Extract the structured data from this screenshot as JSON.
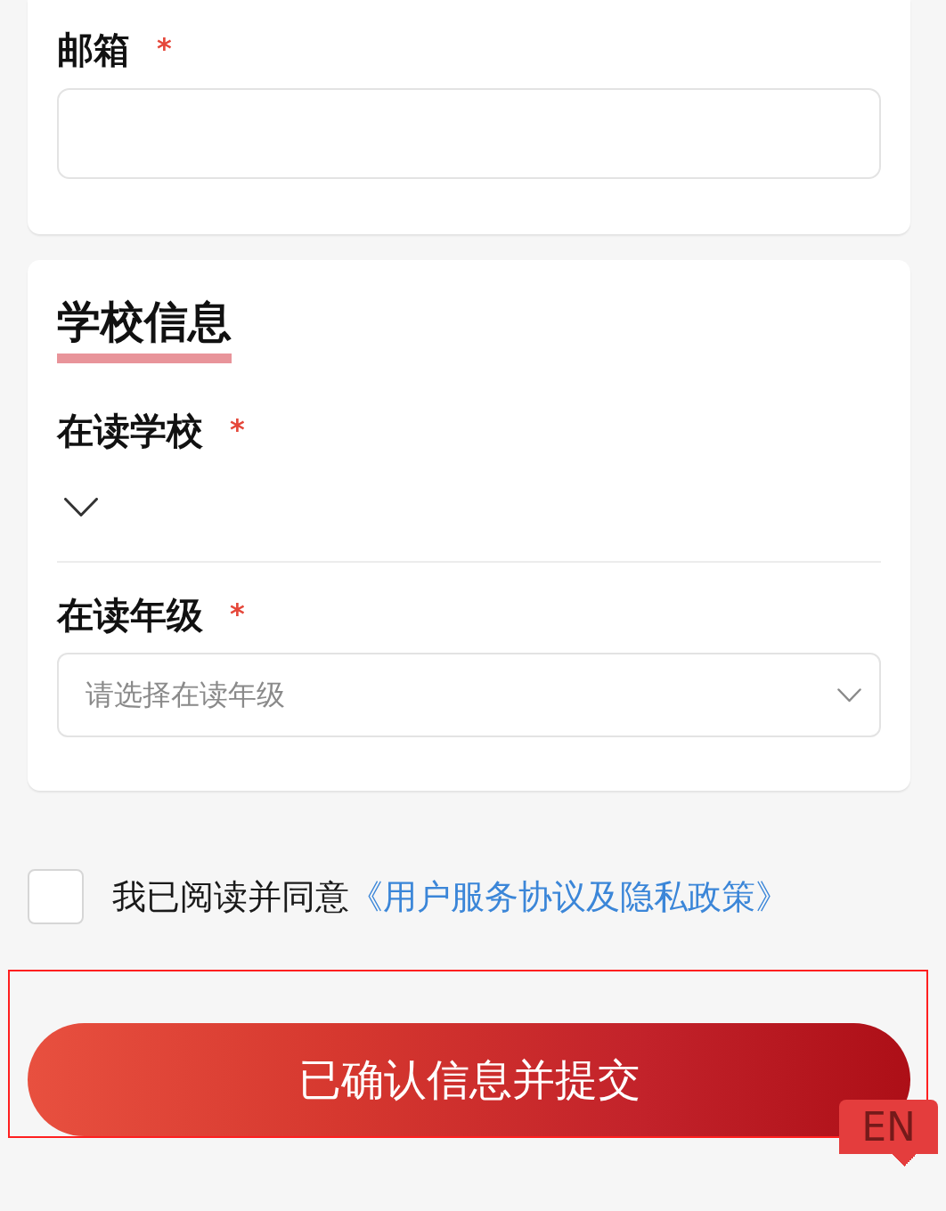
{
  "sections": [
    {
      "fields": [
        {
          "kind": "text",
          "label": "邮箱",
          "required_mark": "*"
        }
      ]
    },
    {
      "title": "学校信息",
      "fields": [
        {
          "kind": "inline_select",
          "label": "在读学校",
          "required_mark": "*"
        },
        {
          "kind": "select",
          "label": "在读年级",
          "required_mark": "*",
          "placeholder": "请选择在读年级"
        }
      ]
    }
  ],
  "agreement": {
    "checked": false,
    "text": "我已阅读并同意",
    "link": "《用户服务协议及隐私政策》"
  },
  "submit_button": {
    "label": "已确认信息并提交",
    "highlighted": true
  },
  "language_button": {
    "label": "EN"
  }
}
